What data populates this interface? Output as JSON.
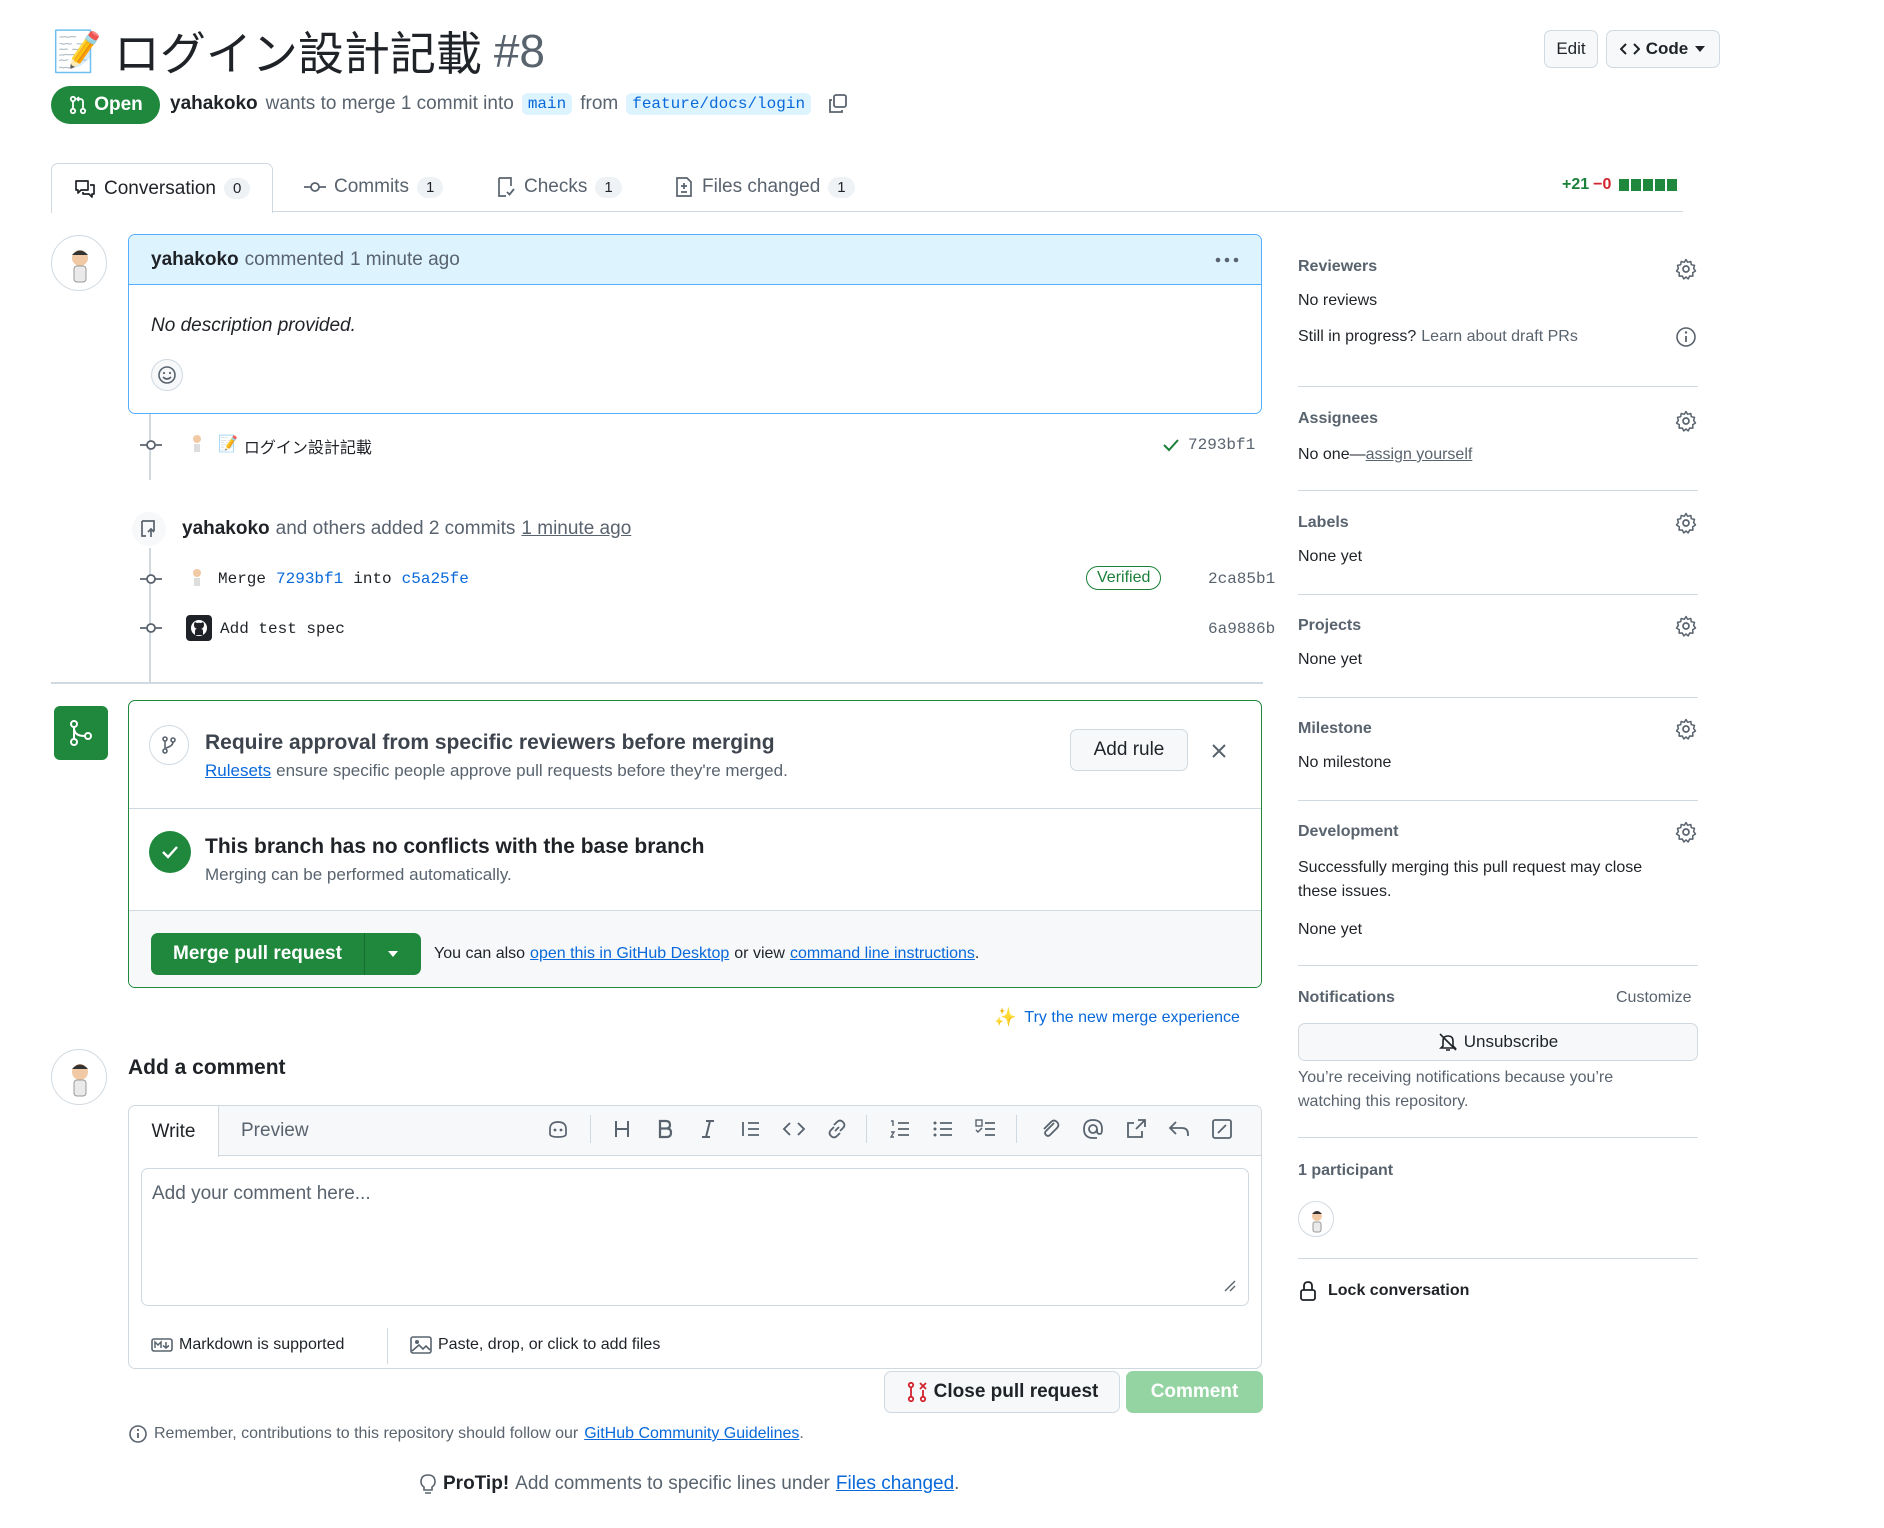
{
  "header": {
    "title_emoji": "📝",
    "title": "ログイン設計記載",
    "number": "#8",
    "edit_label": "Edit",
    "code_label": "Code"
  },
  "status": {
    "state": "Open",
    "author": "yahakoko",
    "merge_text": "wants to merge 1 commit into",
    "base_branch": "main",
    "from_text": "from",
    "head_branch": "feature/docs/login"
  },
  "tabs": [
    {
      "label": "Conversation",
      "count": "0"
    },
    {
      "label": "Commits",
      "count": "1"
    },
    {
      "label": "Checks",
      "count": "1"
    },
    {
      "label": "Files changed",
      "count": "1"
    }
  ],
  "diffstat": {
    "additions": "+21",
    "deletions": "−0"
  },
  "comment": {
    "author": "yahakoko",
    "action": "commented",
    "time": "1 minute ago",
    "body": "No description provided."
  },
  "commits": {
    "first": {
      "message_emoji": "📝",
      "message": "ログイン設計記載",
      "sha": "7293bf1"
    },
    "push_event": {
      "author": "yahakoko",
      "text": "and others added 2 commits",
      "time": "1 minute ago"
    },
    "merge": {
      "prefix": "Merge",
      "from_sha": "7293bf1",
      "into": "into",
      "to_sha": "c5a25fe",
      "badge": "Verified",
      "sha": "2ca85b1"
    },
    "spec": {
      "message": "Add test spec",
      "sha": "6a9886b"
    }
  },
  "merge_box": {
    "rule_title": "Require approval from specific reviewers before merging",
    "rule_link": "Rulesets",
    "rule_desc": "ensure specific people approve pull requests before they're merged.",
    "add_rule": "Add rule",
    "conflict_title": "This branch has no conflicts with the base branch",
    "conflict_desc": "Merging can be performed automatically.",
    "merge_button": "Merge pull request",
    "also_text": "You can also",
    "desktop_link": "open this in GitHub Desktop",
    "or_view": "or view",
    "cli_link": "command line instructions",
    "period": "."
  },
  "try_merge": "Try the new merge experience",
  "add_comment": {
    "heading": "Add a comment",
    "write_tab": "Write",
    "preview_tab": "Preview",
    "placeholder": "Add your comment here...",
    "markdown": "Markdown is supported",
    "files": "Paste, drop, or click to add files",
    "close_button": "Close pull request",
    "comment_button": "Comment",
    "remember": "Remember, contributions to this repository should follow our",
    "guidelines_link": "GitHub Community Guidelines",
    "protip_label": "ProTip!",
    "protip_text": "Add comments to specific lines under",
    "protip_link": "Files changed"
  },
  "sidebar": {
    "reviewers": {
      "title": "Reviewers",
      "value": "No reviews",
      "draft_q": "Still in progress?",
      "draft_link": "Learn about draft PRs"
    },
    "assignees": {
      "title": "Assignees",
      "value": "No one—",
      "link": "assign yourself"
    },
    "labels": {
      "title": "Labels",
      "value": "None yet"
    },
    "projects": {
      "title": "Projects",
      "value": "None yet"
    },
    "milestone": {
      "title": "Milestone",
      "value": "No milestone"
    },
    "development": {
      "title": "Development",
      "desc_1": "Successfully merging this pull request may close",
      "desc_2": "these issues.",
      "value": "None yet"
    },
    "notifications": {
      "title": "Notifications",
      "customize": "Customize",
      "unsubscribe": "Unsubscribe",
      "reason_1": "You’re receiving notifications because you’re",
      "reason_2": "watching this repository."
    },
    "participants": {
      "title": "1 participant"
    },
    "lock": "Lock conversation"
  },
  "colors": {
    "accent": "#0969da",
    "success": "#1f883d",
    "danger": "#d1242f",
    "muted": "#59636e"
  }
}
